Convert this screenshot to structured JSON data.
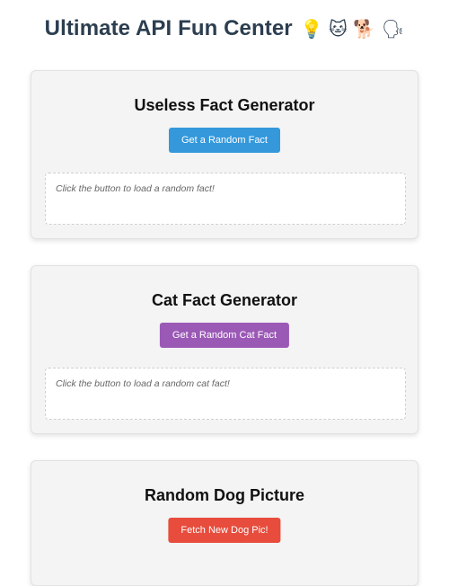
{
  "page": {
    "title": "Ultimate API Fun Center",
    "title_emojis": "💡 🐱 🐕 🗣"
  },
  "cards": [
    {
      "title": "Useless Fact Generator",
      "button_label": "Get a Random Fact",
      "button_color": "#3498db",
      "result_text": "Click the button to load a random fact!"
    },
    {
      "title": "Cat Fact Generator",
      "button_label": "Get a Random Cat Fact",
      "button_color": "#9b59b6",
      "result_text": "Click the button to load a random cat fact!"
    },
    {
      "title": "Random Dog Picture",
      "button_label": "Fetch New Dog Pic!",
      "button_color": "#e74c3c"
    }
  ],
  "colors": {
    "title_text": "#2c3e50",
    "card_background": "#f4f4f4"
  }
}
